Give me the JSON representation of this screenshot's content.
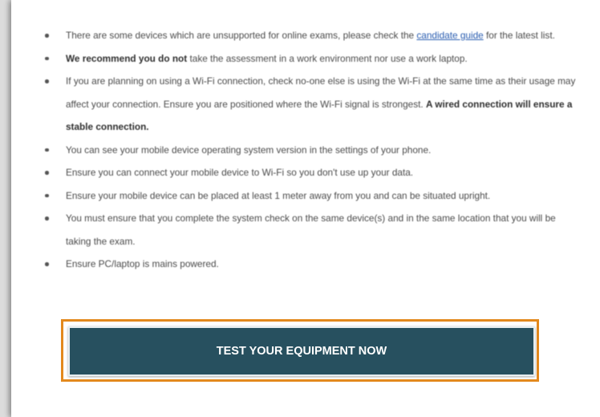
{
  "bullets": [
    {
      "pre": "There are some devices which are unsupported for online exams, please check the ",
      "link": "candidate guide",
      "post": " for the latest list."
    },
    {
      "bold": "We recommend you do not",
      "text": " take the assessment in a work environment nor use a work laptop."
    },
    {
      "text": "If you are planning on using a Wi-Fi connection, check no-one else is using the Wi-Fi at the same time as their usage may affect your connection. Ensure you are positioned where the Wi-Fi signal is strongest. ",
      "bold": "A wired connection will ensure a stable connection."
    },
    {
      "text": "You can see your mobile device operating system version in the settings of your phone."
    },
    {
      "text": "Ensure you can connect your mobile device to Wi-Fi so you don't use up your data."
    },
    {
      "text": "Ensure your mobile device can be placed at least 1 meter away from you and can be situated upright."
    },
    {
      "text": "You must ensure that you complete the system check on the same device(s) and in the same location that you will be taking the exam."
    },
    {
      "text": "Ensure PC/laptop is mains powered."
    }
  ],
  "cta": {
    "label": "TEST YOUR EQUIPMENT NOW"
  },
  "colors": {
    "button_bg": "#27505f",
    "highlight": "#e3891d",
    "link": "#2a5db0"
  }
}
